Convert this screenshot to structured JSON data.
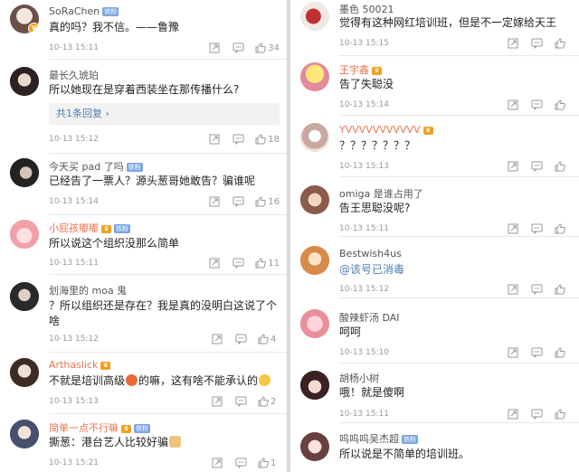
{
  "left": [
    {
      "name": "SoRaChen",
      "name_color": "normal",
      "badges": [
        "vip"
      ],
      "text": "真的吗？我不信。——鲁豫",
      "time": "10-13 15:11",
      "likes": "34",
      "reply": "",
      "avatar_color": "#d8c9c0",
      "verified": true
    },
    {
      "name": "最长久琥珀",
      "name_color": "normal",
      "badges": [],
      "text": "所以她现在是穿着西装坐在那传播什么?",
      "time": "10-13 15:12",
      "likes": "18",
      "reply": "共1条回复 ›",
      "avatar_color": "#5a4a4a",
      "verified": false
    },
    {
      "name": "今天买 pad 了吗",
      "name_color": "normal",
      "badges": [
        "vip"
      ],
      "text": "已经告了一票人？源头葱哥她敢告？骗谁呢",
      "time": "10-13 15:14",
      "likes": "16",
      "reply": "",
      "avatar_color": "#3b3b3b",
      "verified": false
    },
    {
      "name": "小屁孩嘟嘟",
      "name_color": "orange",
      "badges": [
        "crown",
        "vip"
      ],
      "text": "所以说这个组织没那么简单",
      "time": "10-13 15:11",
      "likes": "11",
      "reply": "",
      "avatar_color": "#f2b8b8",
      "verified": false
    },
    {
      "name": "划海里的 moa 鬼",
      "name_color": "normal",
      "badges": [],
      "text": "？所以组织还是存在？我是真的没明白这说了个啥",
      "time": "10-13 15:12",
      "likes": "4",
      "reply": "",
      "avatar_color": "#4a4a4a",
      "verified": false
    },
    {
      "name": "Arthaslick",
      "name_color": "orange",
      "badges": [
        "crown"
      ],
      "text": "不就是培训高级",
      "text2": "的嘛，这有啥不能承认的",
      "time": "10-13 15:13",
      "likes": "2",
      "reply": "",
      "avatar_color": "#6a5040",
      "verified": false
    },
    {
      "name": "简单一点不行嘛",
      "name_color": "orange",
      "badges": [
        "crown",
        "vip"
      ],
      "text": "撕葱：港台艺人比较好骗",
      "time": "10-13 15:21",
      "likes": "1",
      "reply": "",
      "avatar_color": "#7a8ab0",
      "verified": false
    }
  ],
  "right": [
    {
      "name": "墨色 50021",
      "name_color": "normal",
      "badges": [],
      "text": "觉得有这种网红培训班，但是不一定嫁给天王",
      "time": "10-13 15:15",
      "reply": "",
      "avatar_color": "#c03030"
    },
    {
      "name": "王宇鑫",
      "name_color": "orange",
      "badges": [
        "crown"
      ],
      "text": "告了失聪没",
      "time": "10-13 15:14",
      "reply": "",
      "avatar_color": "#f5d050"
    },
    {
      "name": "YVVVVVVVVVVV",
      "name_color": "orange",
      "badges": [
        "crown"
      ],
      "text": "？？？？？？？",
      "time": "10-13 15:13",
      "reply": "",
      "avatar_color": "#e8d8d0"
    },
    {
      "name": "omiga 是谁占用了",
      "name_color": "normal",
      "badges": [],
      "text": "告王思聪没呢?",
      "time": "10-13 15:11",
      "reply": "",
      "avatar_color": "#c89080"
    },
    {
      "name": "Bestwish4us",
      "name_color": "normal",
      "badges": [],
      "text": "@该号已消毒",
      "mention": true,
      "time": "10-13 15:12",
      "reply": "",
      "avatar_color": "#e0a860"
    },
    {
      "name": "酸辣虾汤 DAI",
      "name_color": "normal",
      "badges": [],
      "text": "呵呵",
      "time": "10-13 15:10",
      "reply": "",
      "avatar_color": "#f0b0b8"
    },
    {
      "name": "胡杨小树",
      "name_color": "normal",
      "badges": [],
      "text": "哦！就是傻啊",
      "time": "10-13 15:11",
      "reply": "",
      "avatar_color": "#5a3a3a"
    },
    {
      "name": "呜呜呜吴杰超",
      "name_color": "normal",
      "badges": [
        "vip"
      ],
      "text": "所以说是不简单的培训班。",
      "time": "10-13 15:10",
      "reply": "",
      "avatar_color": "#e8c0c0"
    }
  ],
  "labels": {
    "vip_tag": "铁粉"
  },
  "icons": {
    "share": "share-icon",
    "comment": "comment-icon",
    "like": "like-icon"
  },
  "colors": {
    "orange_name": "#eb7350",
    "link": "#507daf",
    "time": "#999999"
  }
}
